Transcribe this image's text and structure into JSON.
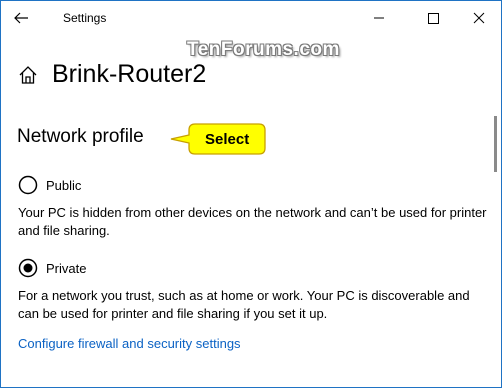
{
  "window": {
    "title": "Settings",
    "watermark": "TenForums.com"
  },
  "page": {
    "title": "Brink-Router2"
  },
  "network_profile": {
    "heading": "Network profile",
    "callout": "Select",
    "selected": "Private",
    "options": [
      {
        "label": "Public",
        "checked": false,
        "description": "Your PC is hidden from other devices on the network and can’t be used for printer and file sharing."
      },
      {
        "label": "Private",
        "checked": true,
        "description": "For a network you trust, such as at home or work. Your PC is discoverable and can be used for printer and file sharing if you set it up."
      }
    ]
  },
  "links": {
    "firewall": "Configure firewall and security settings"
  },
  "colors": {
    "accent": "#1f73c4",
    "link": "#0b62c4",
    "callout_fill": "#ffff00",
    "callout_border": "#c8a000"
  }
}
